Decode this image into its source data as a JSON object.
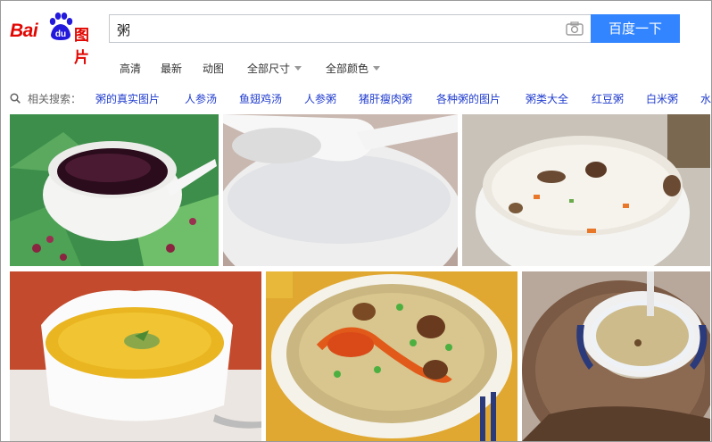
{
  "logo": {
    "text_bai": "Bai",
    "text_du": "du",
    "text_tupian": "图片"
  },
  "search": {
    "query": "粥",
    "button_label": "百度一下",
    "camera_icon": "camera-icon"
  },
  "filters": [
    {
      "label": "高清",
      "dropdown": false
    },
    {
      "label": "最新",
      "dropdown": false
    },
    {
      "label": "动图",
      "dropdown": false
    },
    {
      "label": "全部尺寸",
      "dropdown": true
    },
    {
      "label": "全部颜色",
      "dropdown": true
    }
  ],
  "related": {
    "label": "相关搜索：",
    "items": [
      "粥的真实图片",
      "人参汤",
      "鱼翅鸡汤",
      "人参粥",
      "猪肝瘦肉粥",
      "各种粥的图片",
      "粥类大全",
      "红豆粥",
      "白米粥",
      "水"
    ]
  },
  "images": [
    {
      "name": "black-rice-porridge-image",
      "alt": "black rice porridge"
    },
    {
      "name": "white-rice-porridge-image",
      "alt": "white porridge with spoon"
    },
    {
      "name": "mushroom-congee-image",
      "alt": "congee with mushrooms"
    },
    {
      "name": "millet-porridge-image",
      "alt": "millet porridge"
    },
    {
      "name": "crab-congee-image",
      "alt": "crab and mushroom congee"
    },
    {
      "name": "millet-bowl-image",
      "alt": "small bowl of millet porridge"
    }
  ],
  "colors": {
    "brand_red": "#e10601",
    "brand_blue": "#2319dc",
    "button_blue": "#3385ff",
    "link_blue": "#1f3bce"
  }
}
